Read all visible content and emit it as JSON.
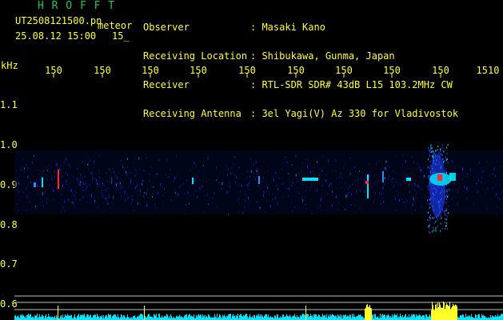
{
  "header": {
    "brand": "H R O F F T",
    "filename": "UT2508121500.pn",
    "datetime": "25.08.12 15:00",
    "sub": "15_",
    "mode": "meteor",
    "fields": [
      {
        "label": "Observer",
        "value": ": Masaki Kano"
      },
      {
        "label": "Receiving Location",
        "value": ": Shibukawa, Gunma, Japan"
      },
      {
        "label": "Receiver",
        "value": ": RTL-SDR SDR# 43dB L15 103.2MHz CW"
      },
      {
        "label": "Receiving Antenna",
        "value": ": 3el Yagi(V) Az 330 for Vladivostok"
      }
    ]
  },
  "axis": {
    "unit": "kHz",
    "x_ticks": [
      "150",
      "150",
      "150",
      "150",
      "150",
      "150",
      "150",
      "150",
      "150",
      "1510"
    ],
    "y_ticks": [
      "1.1",
      "1.0",
      "0.9",
      "0.8",
      "0.7",
      "0.6"
    ]
  },
  "colors": {
    "header_brand": "#22c55e",
    "header_text": "#ffff2a",
    "background": "#000000",
    "signal_blue": "#1e3cff",
    "signal_cyan": "#00e5ff",
    "signal_red": "#ff2a2a",
    "noise_yellow": "#ffff2a"
  }
}
